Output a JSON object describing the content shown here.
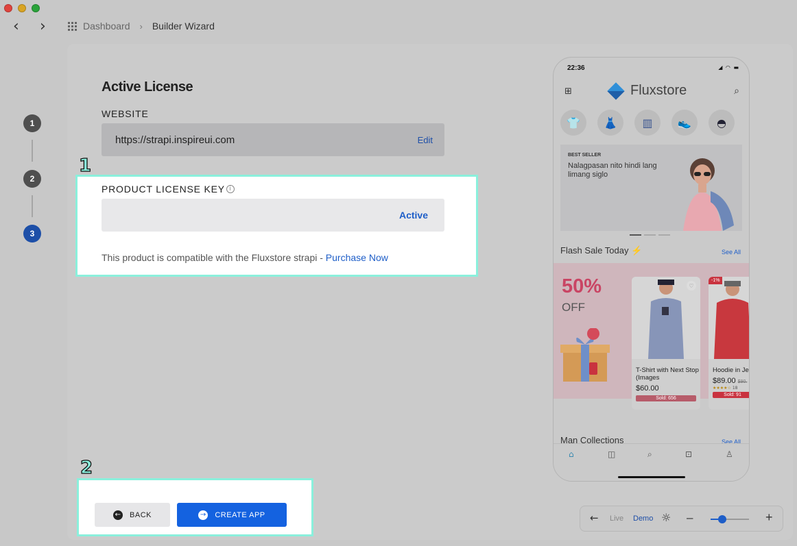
{
  "breadcrumb": {
    "dashboard": "Dashboard",
    "separator": "›",
    "current": "Builder Wizard"
  },
  "steps": [
    {
      "label": "1",
      "active": false
    },
    {
      "label": "2",
      "active": false
    },
    {
      "label": "3",
      "active": true
    }
  ],
  "form": {
    "title": "Active License",
    "website_label": "WEBSITE",
    "website_value": "https://strapi.inspireui.com",
    "edit_label": "Edit",
    "license_label": "PRODUCT LICENSE KEY",
    "license_value": "",
    "license_status": "Active",
    "compat_text": "This product is compatible with the Fluxstore strapi - ",
    "purchase_link": "Purchase Now"
  },
  "highlights": {
    "first": "1",
    "second": "2"
  },
  "buttons": {
    "back": "BACK",
    "create": "CREATE APP"
  },
  "phone": {
    "time": "22:36",
    "brand": "Fluxstore",
    "banner_tag": "BEST SELLER",
    "banner_text": "Nalagpasan nito hindi lang limang siglo",
    "flash_title": "Flash Sale Today ⚡",
    "see_all": "See All",
    "promo_pct": "50%",
    "promo_off": "OFF",
    "products": [
      {
        "name": "T-Shirt with Next Stop (Images",
        "price": "$60.00",
        "sold": "Sold: 656"
      },
      {
        "name": "Hoodie in Je",
        "price": "$89.00",
        "old_price": "$90.",
        "discount": "-1%",
        "rating": "★★★★☆",
        "reviews": "18",
        "sold": "Sold: 91"
      }
    ],
    "men_title": "Man Collections",
    "men_see_all": "See All"
  },
  "toolbar": {
    "live": "Live",
    "demo": "Demo",
    "minus": "–",
    "plus": "+",
    "zoom_level": 0.3
  },
  "colors": {
    "accent": "#1462e0",
    "highlight": "#8af0dc",
    "active_step": "#1d4fa8"
  }
}
